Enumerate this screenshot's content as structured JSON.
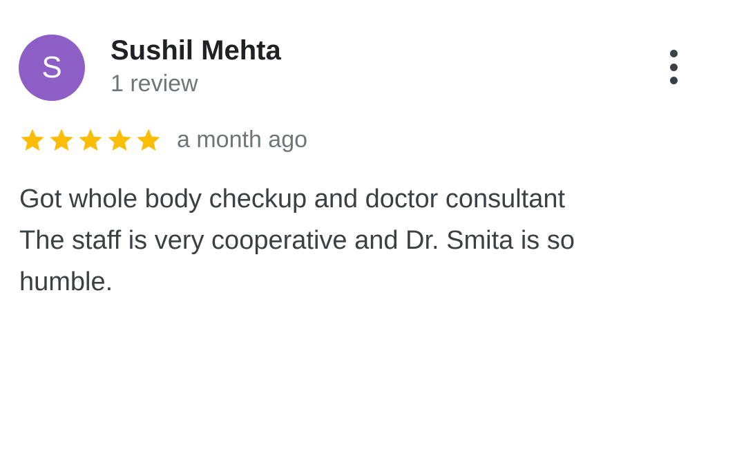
{
  "review": {
    "avatar_letter": "S",
    "avatar_color": "#8e5ec7",
    "author_name": "Sushil Mehta",
    "review_count": "1 review",
    "rating": 5,
    "rating_max": 5,
    "star_color": "#fbbc04",
    "time": "a month ago",
    "text": "Got whole body checkup and doctor consultant\nThe staff is very cooperative and Dr. Smita is so\nhumble.",
    "more_icon": "more-vert-icon"
  }
}
